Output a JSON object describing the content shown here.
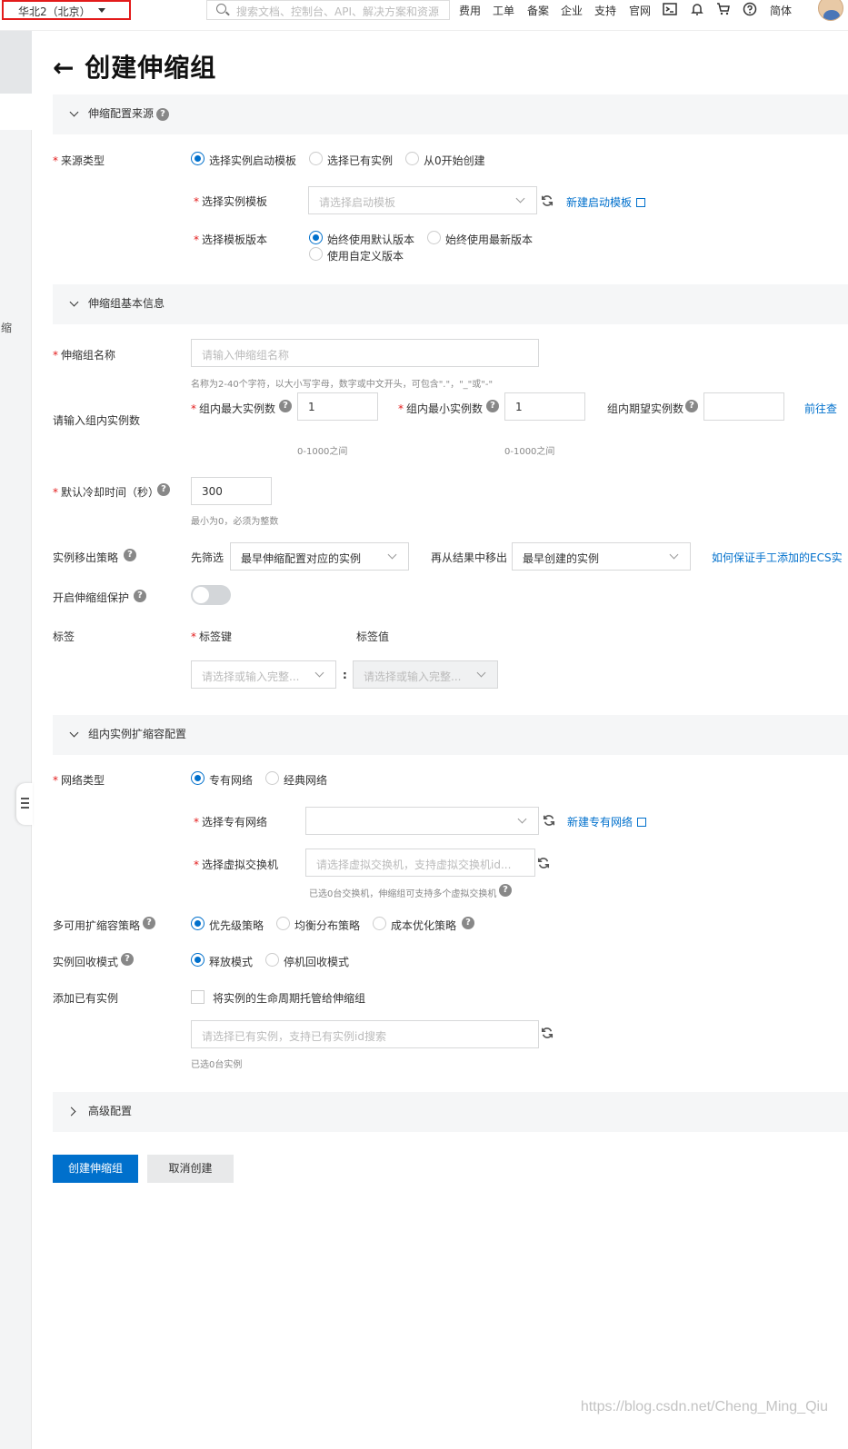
{
  "topbar": {
    "region": "华北2（北京）",
    "search_placeholder": "搜索文档、控制台、API、解决方案和资源",
    "nav": [
      "费用",
      "工单",
      "备案",
      "企业",
      "支持",
      "官网"
    ],
    "lang": "简体",
    "icons": [
      "terminal-icon",
      "bell-icon",
      "cart-icon",
      "help-icon"
    ]
  },
  "sidebar": {
    "collapsed_text": "缩"
  },
  "page": {
    "title": "← 创建伸缩组"
  },
  "section1": {
    "title": "伸缩配置来源",
    "source_type": {
      "label": "来源类型",
      "options": [
        "选择实例启动模板",
        "选择已有实例",
        "从0开始创建"
      ],
      "selected": 0
    },
    "template": {
      "label": "选择实例模板",
      "placeholder": "请选择启动模板",
      "link": "新建启动模板"
    },
    "version": {
      "label": "选择模板版本",
      "options": [
        "始终使用默认版本",
        "始终使用最新版本",
        "使用自定义版本"
      ],
      "selected": 0
    }
  },
  "section2": {
    "title": "伸缩组基本信息",
    "name": {
      "label": "伸缩组名称",
      "placeholder": "请输入伸缩组名称",
      "hint": "名称为2-40个字符，以大小写字母，数字或中文开头，可包含\".\"，\"_\"或\"-\""
    },
    "instances": {
      "label": "请输入组内实例数",
      "max_label": "组内最大实例数",
      "max_value": "1",
      "max_hint": "0-1000之间",
      "min_label": "组内最小实例数",
      "min_value": "1",
      "min_hint": "0-1000之间",
      "desired_label": "组内期望实例数",
      "desired_value": "",
      "link": "前往查"
    },
    "cooldown": {
      "label": "默认冷却时间（秒）",
      "value": "300",
      "hint": "最小为0，必须为整数"
    },
    "removal": {
      "label": "实例移出策略",
      "filter_label": "先筛选",
      "filter_value": "最早伸缩配置对应的实例",
      "then_label": "再从结果中移出",
      "then_value": "最早创建的实例",
      "link": "如何保证手工添加的ECS实"
    },
    "protection": {
      "label": "开启伸缩组保护",
      "enabled": false
    },
    "tags": {
      "label": "标签",
      "key_label": "标签键",
      "value_label": "标签值",
      "key_placeholder": "请选择或输入完整...",
      "value_placeholder": "请选择或输入完整...",
      "separator": ":"
    }
  },
  "section3": {
    "title": "组内实例扩缩容配置",
    "network": {
      "label": "网络类型",
      "options": [
        "专有网络",
        "经典网络"
      ],
      "selected": 0
    },
    "vpc": {
      "label": "选择专有网络",
      "value": "",
      "link": "新建专有网络"
    },
    "vswitch": {
      "label": "选择虚拟交换机",
      "placeholder": "请选择虚拟交换机，支持虚拟交换机id...",
      "hint": "已选0台交换机，伸缩组可支持多个虚拟交换机"
    },
    "zone_policy": {
      "label": "多可用扩缩容策略",
      "options": [
        "优先级策略",
        "均衡分布策略",
        "成本优化策略"
      ],
      "selected": 0
    },
    "recycle": {
      "label": "实例回收模式",
      "options": [
        "释放模式",
        "停机回收模式"
      ],
      "selected": 0
    },
    "existing": {
      "label": "添加已有实例",
      "checkbox_label": "将实例的生命周期托管给伸缩组",
      "placeholder": "请选择已有实例，支持已有实例id搜索",
      "hint": "已选0台实例"
    }
  },
  "section4": {
    "title": "高级配置"
  },
  "buttons": {
    "create": "创建伸缩组",
    "cancel": "取消创建"
  },
  "watermark": "https://blog.csdn.net/Cheng_Ming_Qiu"
}
